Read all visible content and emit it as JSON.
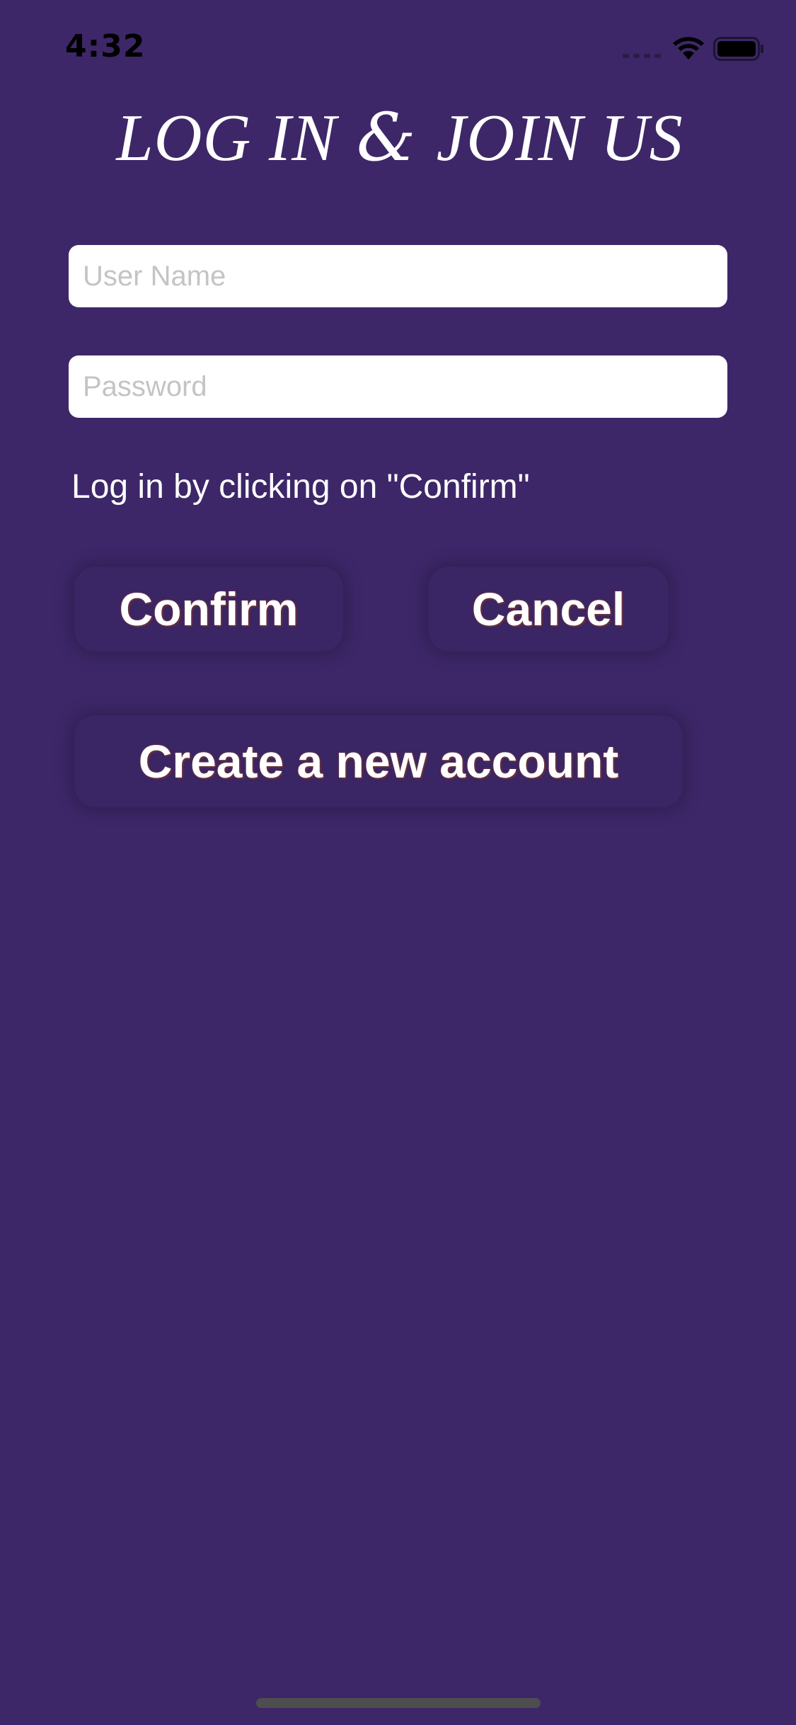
{
  "status_bar": {
    "time": "4:32",
    "signal_icon": "cellular-signal-icon",
    "wifi_icon": "wifi-icon",
    "battery_icon": "battery-icon"
  },
  "header": {
    "title_part1": "LOG IN",
    "title_amp": "&",
    "title_part2": "JOIN US"
  },
  "form": {
    "username_placeholder": "User Name",
    "username_value": "",
    "password_placeholder": "Password",
    "password_value": "",
    "hint": "Log in by clicking on \"Confirm\""
  },
  "buttons": {
    "confirm_label": "Confirm",
    "cancel_label": "Cancel",
    "create_label": "Create a new account"
  },
  "colors": {
    "background": "#3d2768",
    "field_background": "#ffffff",
    "placeholder": "#c4c4c6",
    "text": "#ffffff"
  }
}
